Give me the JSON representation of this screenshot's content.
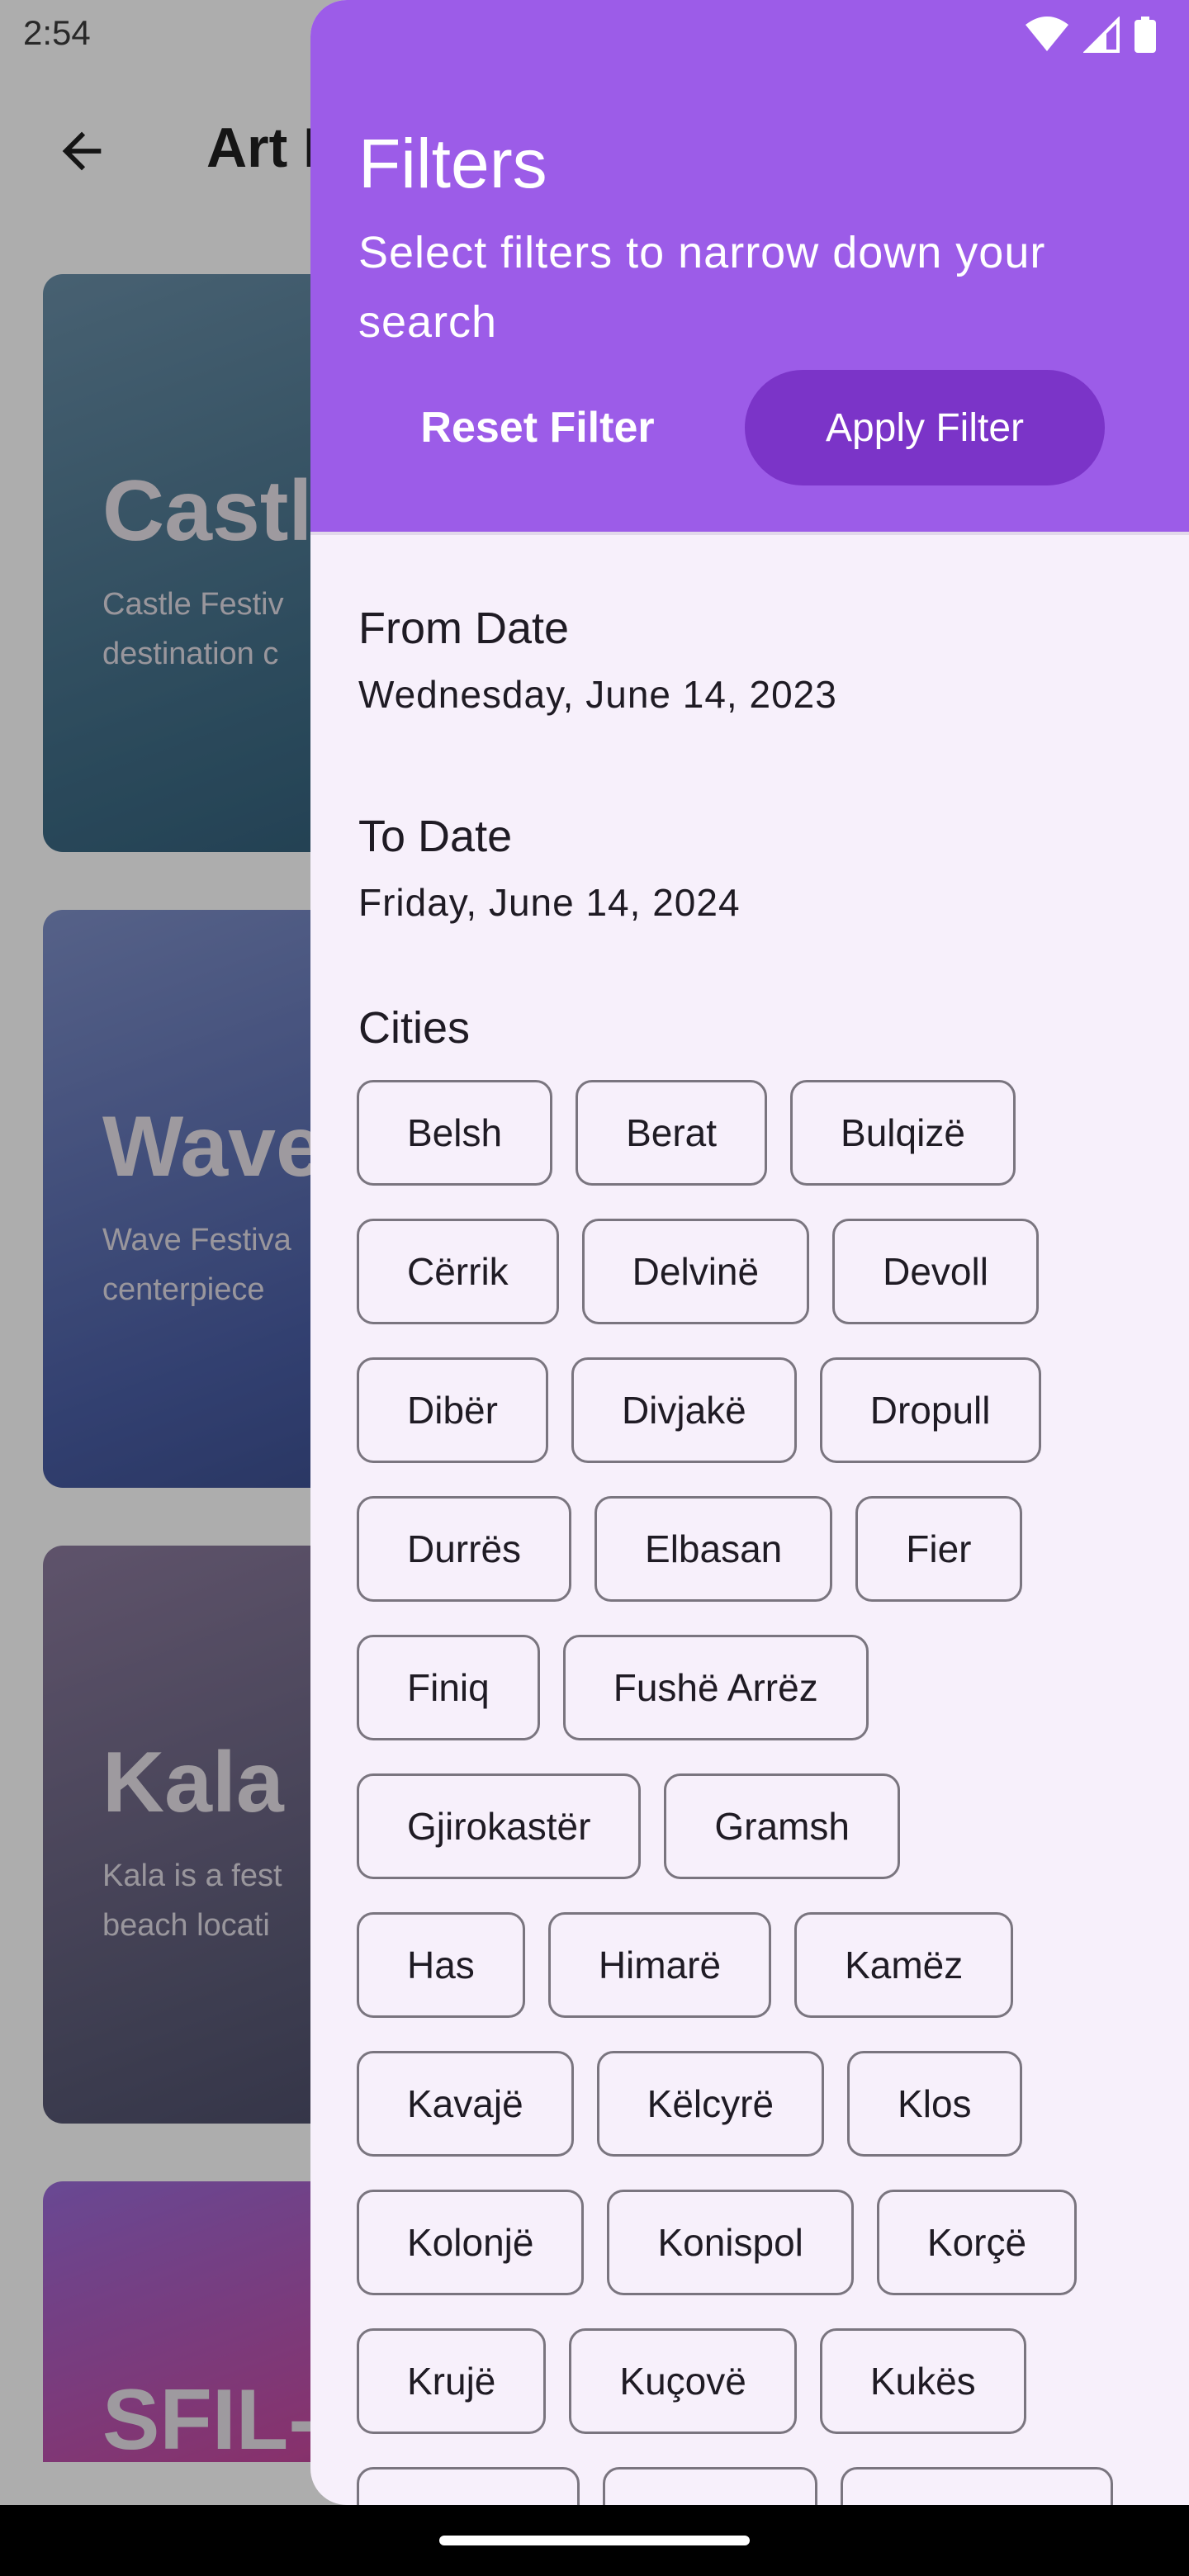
{
  "status_bar": {
    "time": "2:54"
  },
  "app_bar": {
    "title": "Art F"
  },
  "background_cards": [
    {
      "title": "Castl",
      "description": "Castle Festiv\ndestination c",
      "colors": [
        "#6a8fa8",
        "#3f6c86",
        "#1e4b67"
      ]
    },
    {
      "title": "Wave",
      "description": "Wave Festiva\ncenterpiece",
      "colors": [
        "#7f90c9",
        "#4b5fa6",
        "#24356e"
      ]
    },
    {
      "title": "Kala I",
      "description": "Kala is a fest\nbeach locati",
      "colors": [
        "#8c7b9e",
        "#5b5b77",
        "#343651"
      ]
    },
    {
      "title": "SFIL-",
      "description": "",
      "colors": [
        "#9a6bd9",
        "#c74aa0",
        "#2a1f45"
      ]
    }
  ],
  "drawer": {
    "title": "Filters",
    "subtitle": "Select filters to narrow down your search",
    "reset_label": "Reset Filter",
    "apply_label": "Apply Filter",
    "from_label": "From Date",
    "from_value": "Wednesday, June 14, 2023",
    "to_label": "To Date",
    "to_value": "Friday, June 14, 2024",
    "cities_label": "Cities",
    "city_rows": [
      [
        "Belsh",
        "Berat",
        "Bulqizë"
      ],
      [
        "Cërrik",
        "Delvinë",
        "Devoll"
      ],
      [
        "Dibër",
        "Divjakë",
        "Dropull"
      ],
      [
        "Durrës",
        "Elbasan",
        "Fier"
      ],
      [
        "Finiq",
        "Fushë Arrëz"
      ],
      [
        "Gjirokastër",
        "Gramsh"
      ],
      [
        "Has",
        "Himarë",
        "Kamëz"
      ],
      [
        "Kavajë",
        "Këlcyrë",
        "Klos"
      ],
      [
        "Kolonjë",
        "Konispol",
        "Korçë"
      ],
      [
        "Krujë",
        "Kuçovë",
        "Kukës"
      ],
      [
        "",
        "",
        ""
      ]
    ]
  },
  "colors": {
    "header": "#9c5ce8",
    "apply_button": "#7b34c8",
    "drawer_bg": "#f7f0fb"
  }
}
